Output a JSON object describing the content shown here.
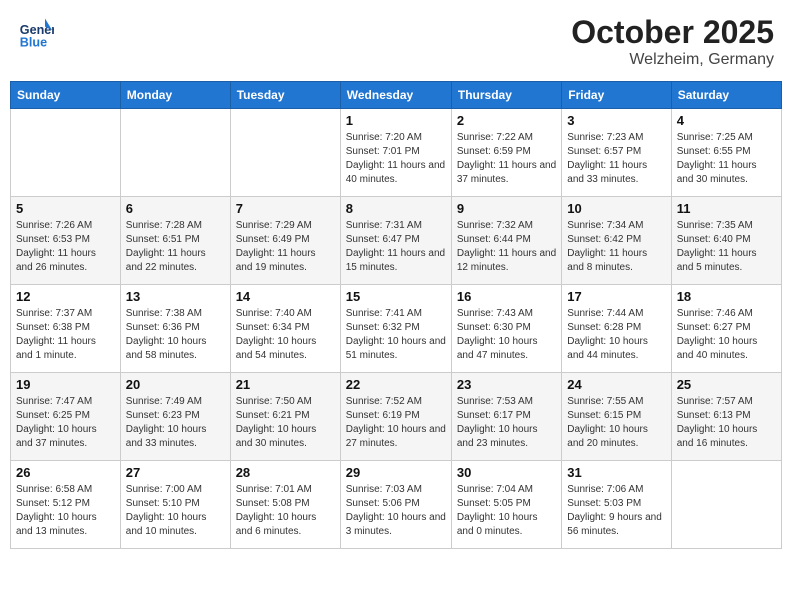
{
  "header": {
    "logo_general": "General",
    "logo_blue": "Blue",
    "month": "October 2025",
    "location": "Welzheim, Germany"
  },
  "weekdays": [
    "Sunday",
    "Monday",
    "Tuesday",
    "Wednesday",
    "Thursday",
    "Friday",
    "Saturday"
  ],
  "weeks": [
    [
      {
        "day": "",
        "info": ""
      },
      {
        "day": "",
        "info": ""
      },
      {
        "day": "",
        "info": ""
      },
      {
        "day": "1",
        "info": "Sunrise: 7:20 AM\nSunset: 7:01 PM\nDaylight: 11 hours and 40 minutes."
      },
      {
        "day": "2",
        "info": "Sunrise: 7:22 AM\nSunset: 6:59 PM\nDaylight: 11 hours and 37 minutes."
      },
      {
        "day": "3",
        "info": "Sunrise: 7:23 AM\nSunset: 6:57 PM\nDaylight: 11 hours and 33 minutes."
      },
      {
        "day": "4",
        "info": "Sunrise: 7:25 AM\nSunset: 6:55 PM\nDaylight: 11 hours and 30 minutes."
      }
    ],
    [
      {
        "day": "5",
        "info": "Sunrise: 7:26 AM\nSunset: 6:53 PM\nDaylight: 11 hours and 26 minutes."
      },
      {
        "day": "6",
        "info": "Sunrise: 7:28 AM\nSunset: 6:51 PM\nDaylight: 11 hours and 22 minutes."
      },
      {
        "day": "7",
        "info": "Sunrise: 7:29 AM\nSunset: 6:49 PM\nDaylight: 11 hours and 19 minutes."
      },
      {
        "day": "8",
        "info": "Sunrise: 7:31 AM\nSunset: 6:47 PM\nDaylight: 11 hours and 15 minutes."
      },
      {
        "day": "9",
        "info": "Sunrise: 7:32 AM\nSunset: 6:44 PM\nDaylight: 11 hours and 12 minutes."
      },
      {
        "day": "10",
        "info": "Sunrise: 7:34 AM\nSunset: 6:42 PM\nDaylight: 11 hours and 8 minutes."
      },
      {
        "day": "11",
        "info": "Sunrise: 7:35 AM\nSunset: 6:40 PM\nDaylight: 11 hours and 5 minutes."
      }
    ],
    [
      {
        "day": "12",
        "info": "Sunrise: 7:37 AM\nSunset: 6:38 PM\nDaylight: 11 hours and 1 minute."
      },
      {
        "day": "13",
        "info": "Sunrise: 7:38 AM\nSunset: 6:36 PM\nDaylight: 10 hours and 58 minutes."
      },
      {
        "day": "14",
        "info": "Sunrise: 7:40 AM\nSunset: 6:34 PM\nDaylight: 10 hours and 54 minutes."
      },
      {
        "day": "15",
        "info": "Sunrise: 7:41 AM\nSunset: 6:32 PM\nDaylight: 10 hours and 51 minutes."
      },
      {
        "day": "16",
        "info": "Sunrise: 7:43 AM\nSunset: 6:30 PM\nDaylight: 10 hours and 47 minutes."
      },
      {
        "day": "17",
        "info": "Sunrise: 7:44 AM\nSunset: 6:28 PM\nDaylight: 10 hours and 44 minutes."
      },
      {
        "day": "18",
        "info": "Sunrise: 7:46 AM\nSunset: 6:27 PM\nDaylight: 10 hours and 40 minutes."
      }
    ],
    [
      {
        "day": "19",
        "info": "Sunrise: 7:47 AM\nSunset: 6:25 PM\nDaylight: 10 hours and 37 minutes."
      },
      {
        "day": "20",
        "info": "Sunrise: 7:49 AM\nSunset: 6:23 PM\nDaylight: 10 hours and 33 minutes."
      },
      {
        "day": "21",
        "info": "Sunrise: 7:50 AM\nSunset: 6:21 PM\nDaylight: 10 hours and 30 minutes."
      },
      {
        "day": "22",
        "info": "Sunrise: 7:52 AM\nSunset: 6:19 PM\nDaylight: 10 hours and 27 minutes."
      },
      {
        "day": "23",
        "info": "Sunrise: 7:53 AM\nSunset: 6:17 PM\nDaylight: 10 hours and 23 minutes."
      },
      {
        "day": "24",
        "info": "Sunrise: 7:55 AM\nSunset: 6:15 PM\nDaylight: 10 hours and 20 minutes."
      },
      {
        "day": "25",
        "info": "Sunrise: 7:57 AM\nSunset: 6:13 PM\nDaylight: 10 hours and 16 minutes."
      }
    ],
    [
      {
        "day": "26",
        "info": "Sunrise: 6:58 AM\nSunset: 5:12 PM\nDaylight: 10 hours and 13 minutes."
      },
      {
        "day": "27",
        "info": "Sunrise: 7:00 AM\nSunset: 5:10 PM\nDaylight: 10 hours and 10 minutes."
      },
      {
        "day": "28",
        "info": "Sunrise: 7:01 AM\nSunset: 5:08 PM\nDaylight: 10 hours and 6 minutes."
      },
      {
        "day": "29",
        "info": "Sunrise: 7:03 AM\nSunset: 5:06 PM\nDaylight: 10 hours and 3 minutes."
      },
      {
        "day": "30",
        "info": "Sunrise: 7:04 AM\nSunset: 5:05 PM\nDaylight: 10 hours and 0 minutes."
      },
      {
        "day": "31",
        "info": "Sunrise: 7:06 AM\nSunset: 5:03 PM\nDaylight: 9 hours and 56 minutes."
      },
      {
        "day": "",
        "info": ""
      }
    ]
  ]
}
